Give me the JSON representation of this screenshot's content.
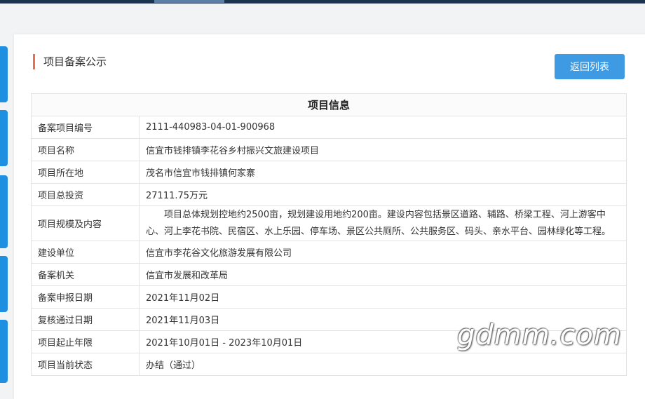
{
  "header": {
    "section_title": "项目备案公示",
    "back_button_label": "返回列表"
  },
  "table": {
    "title": "项目信息",
    "rows": [
      {
        "label": "备案项目编号",
        "value": "2111-440983-04-01-900968"
      },
      {
        "label": "项目名称",
        "value": "信宜市钱排镇李花谷乡村振兴文旅建设项目"
      },
      {
        "label": "项目所在地",
        "value": "茂名市信宜市钱排镇何家寨"
      },
      {
        "label": "项目总投资",
        "value": "27111.75万元"
      },
      {
        "label": "项目规模及内容",
        "value": "项目总体规划控地约2500亩，规划建设用地约200亩。建设内容包括景区道路、辅路、桥梁工程、河上游客中心、河上李花书院、民宿区、水上乐园、停车场、景区公共厕所、公共服务区、码头、亲水平台、园林绿化等工程。"
      },
      {
        "label": "建设单位",
        "value": "信宜市李花谷文化旅游发展有限公司"
      },
      {
        "label": "备案机关",
        "value": "信宜市发展和改革局"
      },
      {
        "label": "备案申报日期",
        "value": "2021年11月02日"
      },
      {
        "label": "复核通过日期",
        "value": "2021年11月03日"
      },
      {
        "label": "项目起止年限",
        "value": "2021年10月01日 - 2023年10月01日"
      },
      {
        "label": "项目当前状态",
        "value": "办结（通过）"
      }
    ]
  },
  "watermark": "gdmm.com",
  "colors": {
    "accent_bar": "#e8704f",
    "button": "#3d9ae3",
    "side_tabs": "#1e8fe1",
    "top_bar": "#1c3350"
  }
}
